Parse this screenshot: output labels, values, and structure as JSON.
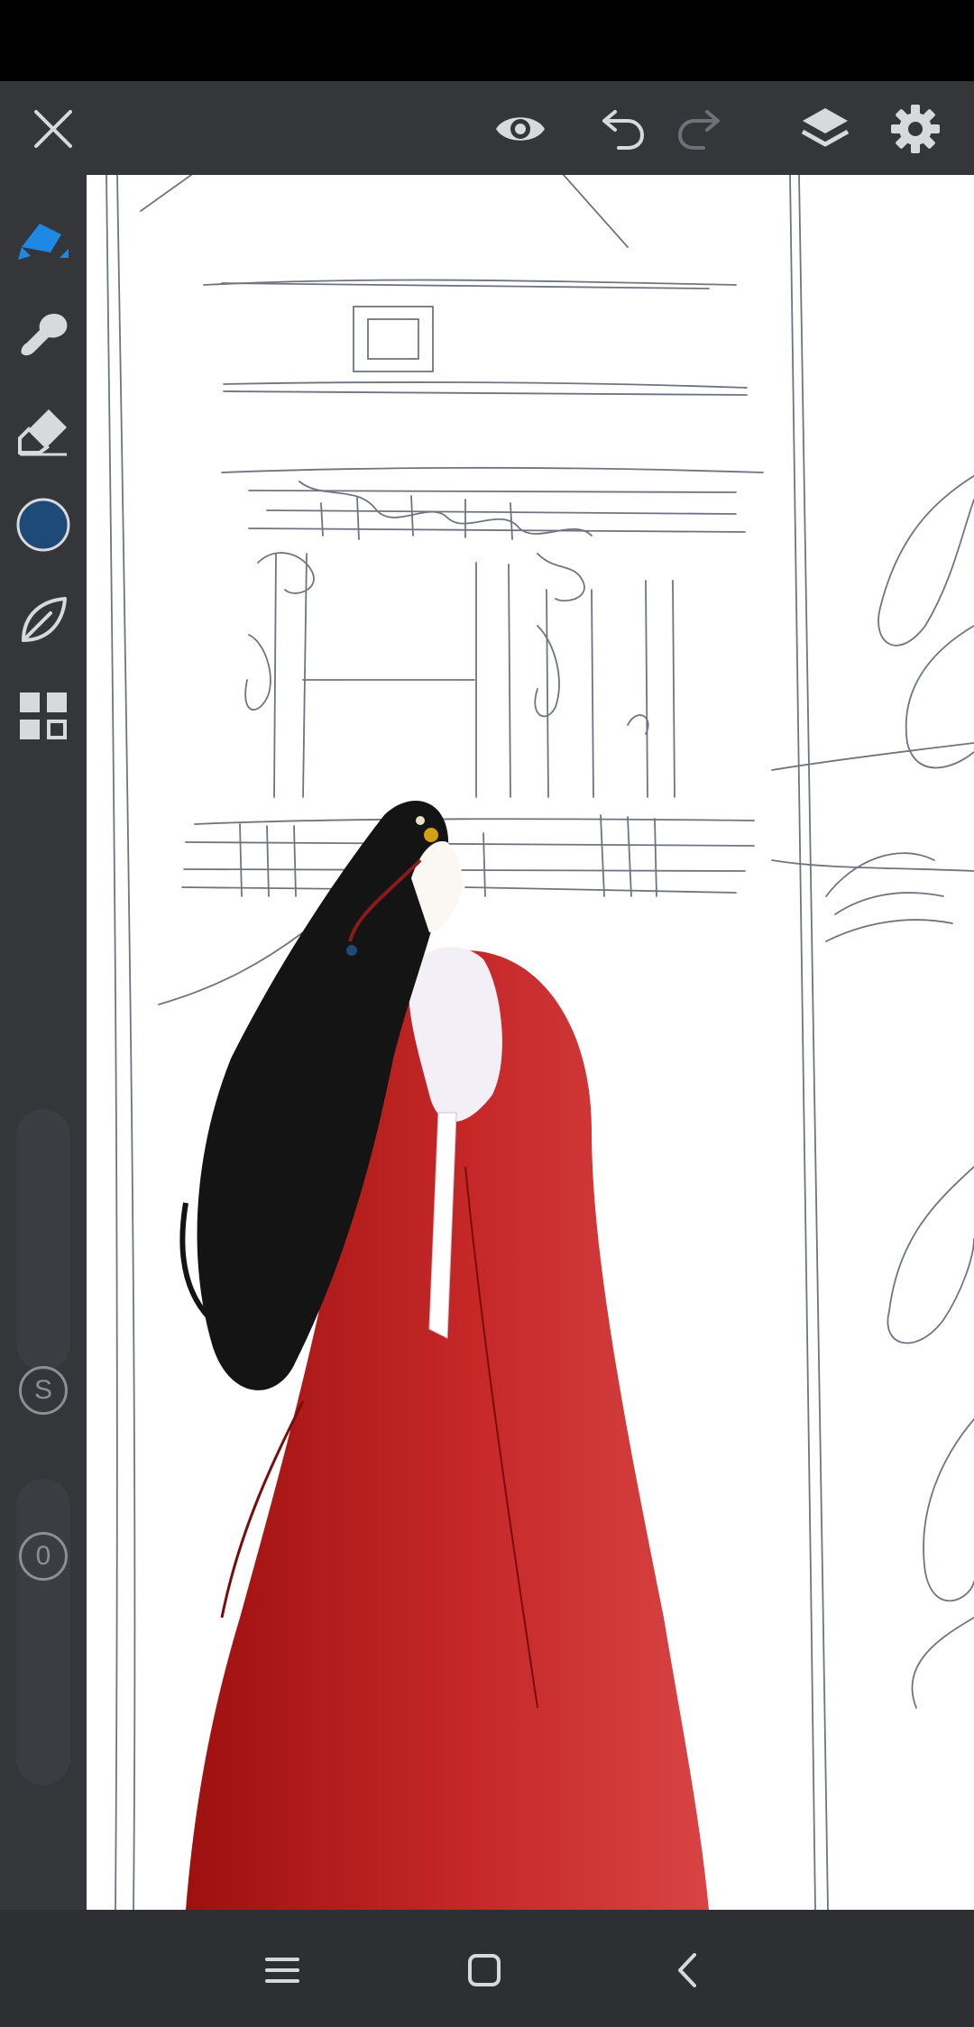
{
  "colors": {
    "accent": "#1e88e5",
    "current_color": "#1e4a78",
    "toolbar_icon": "#d7d9dd",
    "toolbar_icon_disabled": "#6e7176",
    "dress_red": "#b71c1c"
  },
  "toolbar": {
    "icons": [
      "close-icon",
      "eye-icon",
      "undo-icon",
      "redo-icon",
      "layers-icon",
      "settings-icon"
    ]
  },
  "sidebar": {
    "tools": [
      "brush-icon",
      "smudge-icon",
      "eraser-icon",
      "color-swatch",
      "stroke-leaf-icon",
      "grid-icon"
    ],
    "size_label": "S",
    "opacity_label": "0"
  },
  "navigation": {
    "icons": [
      "recents-icon",
      "home-icon",
      "back-icon"
    ]
  }
}
